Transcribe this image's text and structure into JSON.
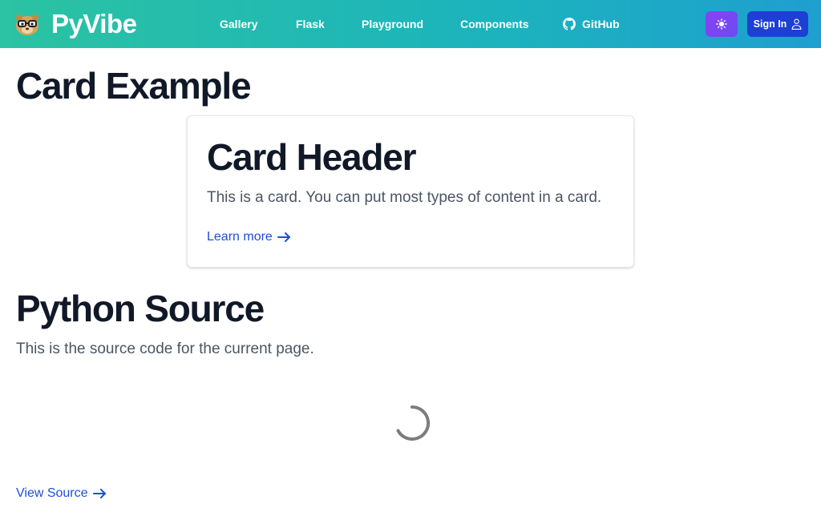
{
  "header": {
    "brand": "PyVibe",
    "nav": [
      {
        "label": "Gallery"
      },
      {
        "label": "Flask"
      },
      {
        "label": "Playground"
      },
      {
        "label": "Components"
      },
      {
        "label": "GitHub",
        "icon": "github-icon"
      }
    ],
    "theme_toggle_icon": "sun-icon",
    "signin_label": "Sign In",
    "signin_icon": "user-icon"
  },
  "main": {
    "card_example_title": "Card Example",
    "card": {
      "header": "Card Header",
      "body": "This is a card. You can put most types of content in a card.",
      "link_label": "Learn more"
    },
    "python_source_title": "Python Source",
    "python_source_desc": "This is the source code for the current page.",
    "loading_icon": "spinner-icon",
    "view_source_label": "View Source"
  },
  "colors": {
    "navbar_gradient": [
      "#2bc3a2",
      "#1e9fd0"
    ],
    "theme_button": "#7c45f4",
    "signin_button": "#1d3fd6",
    "link": "#1d4ed8",
    "heading": "#111827",
    "body_text": "#4b5563"
  }
}
